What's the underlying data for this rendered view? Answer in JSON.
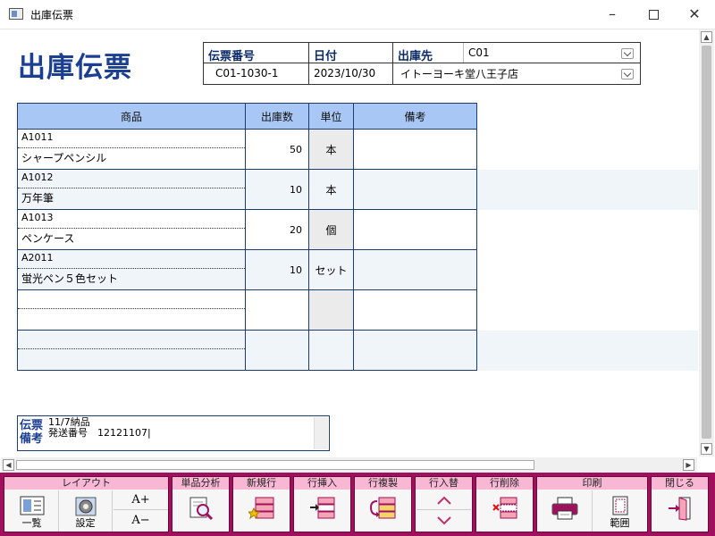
{
  "window": {
    "title": "出庫伝票"
  },
  "page": {
    "heading": "出庫伝票"
  },
  "header": {
    "slip_no_label": "伝票番号",
    "slip_no": "C01-1030-1",
    "date_label": "日付",
    "date": "2023/10/30",
    "dest_label": "出庫先",
    "dest_code": "C01",
    "dest_name": "イトーヨーキ堂八王子店"
  },
  "table": {
    "columns": [
      "商品",
      "出庫数",
      "単位",
      "備考"
    ],
    "rows": [
      {
        "code": "A1011",
        "name": "シャープペンシル",
        "qty": "50",
        "unit": "本",
        "note": ""
      },
      {
        "code": "A1012",
        "name": "万年筆",
        "qty": "10",
        "unit": "本",
        "note": ""
      },
      {
        "code": "A1013",
        "name": "ペンケース",
        "qty": "20",
        "unit": "個",
        "note": ""
      },
      {
        "code": "A2011",
        "name": "蛍光ペン５色セット",
        "qty": "10",
        "unit": "セット",
        "note": ""
      },
      {
        "code": "",
        "name": "",
        "qty": "",
        "unit": "",
        "note": ""
      },
      {
        "code": "",
        "name": "",
        "qty": "",
        "unit": "",
        "note": ""
      }
    ]
  },
  "remarks": {
    "label": "伝票\n備考",
    "text": "11/7納品\n発送番号　12121107|"
  },
  "toolbar": {
    "layout": {
      "title": "レイアウト",
      "list": "一覧",
      "settings": "設定",
      "font_up": "A+",
      "font_down": "A−"
    },
    "item_analysis": {
      "title": "単品分析"
    },
    "new_row": {
      "title": "新規行"
    },
    "insert_row": {
      "title": "行挿入"
    },
    "copy_row": {
      "title": "行複製"
    },
    "swap_row": {
      "title": "行入替"
    },
    "delete_row": {
      "title": "行削除"
    },
    "print": {
      "title": "印刷",
      "range": "範囲"
    },
    "close": {
      "title": "閉じる"
    }
  },
  "colors": {
    "accent": "#1b3f91",
    "header_bg": "#a9c7f5",
    "toolbar": "#a1105c",
    "group_head": "#f8b8d4"
  },
  "icons": [
    "app-icon",
    "minimize-icon",
    "maximize-icon",
    "close-icon",
    "chevron-down-icon",
    "list-icon",
    "gear-icon",
    "font-up-icon",
    "font-down-icon",
    "magnifier-icon",
    "new-row-icon",
    "insert-row-icon",
    "copy-row-icon",
    "arrow-up-icon",
    "arrow-down-icon",
    "delete-row-icon",
    "printer-icon",
    "page-range-icon",
    "exit-door-icon"
  ]
}
